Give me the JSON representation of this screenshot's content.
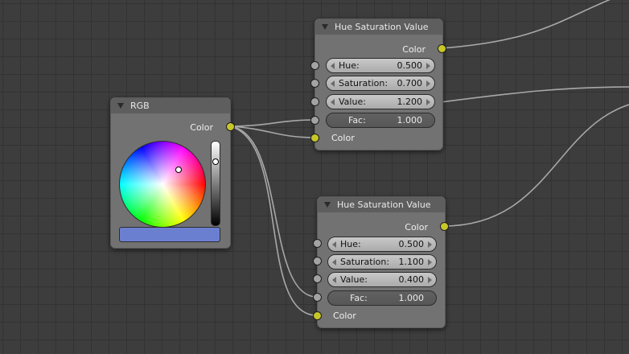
{
  "colors": {
    "color_socket": "#c7c729",
    "value_socket": "#a3a3a3",
    "rgb_swatch": "#6b7fd1",
    "link": "#a8a8a8"
  },
  "rgb_node": {
    "title": "RGB",
    "output_label": "Color"
  },
  "hsv_node_top": {
    "title": "Hue Saturation Value",
    "output_label": "Color",
    "fields": [
      {
        "label": "Hue:",
        "value": "0.500"
      },
      {
        "label": "Saturation:",
        "value": "0.700"
      },
      {
        "label": "Value:",
        "value": "1.200"
      },
      {
        "label": "Fac:",
        "value": "1.000"
      }
    ],
    "color_input_label": "Color"
  },
  "hsv_node_bottom": {
    "title": "Hue Saturation Value",
    "output_label": "Color",
    "fields": [
      {
        "label": "Hue:",
        "value": "0.500"
      },
      {
        "label": "Saturation:",
        "value": "1.100"
      },
      {
        "label": "Value:",
        "value": "0.400"
      },
      {
        "label": "Fac:",
        "value": "1.000"
      }
    ],
    "color_input_label": "Color"
  }
}
